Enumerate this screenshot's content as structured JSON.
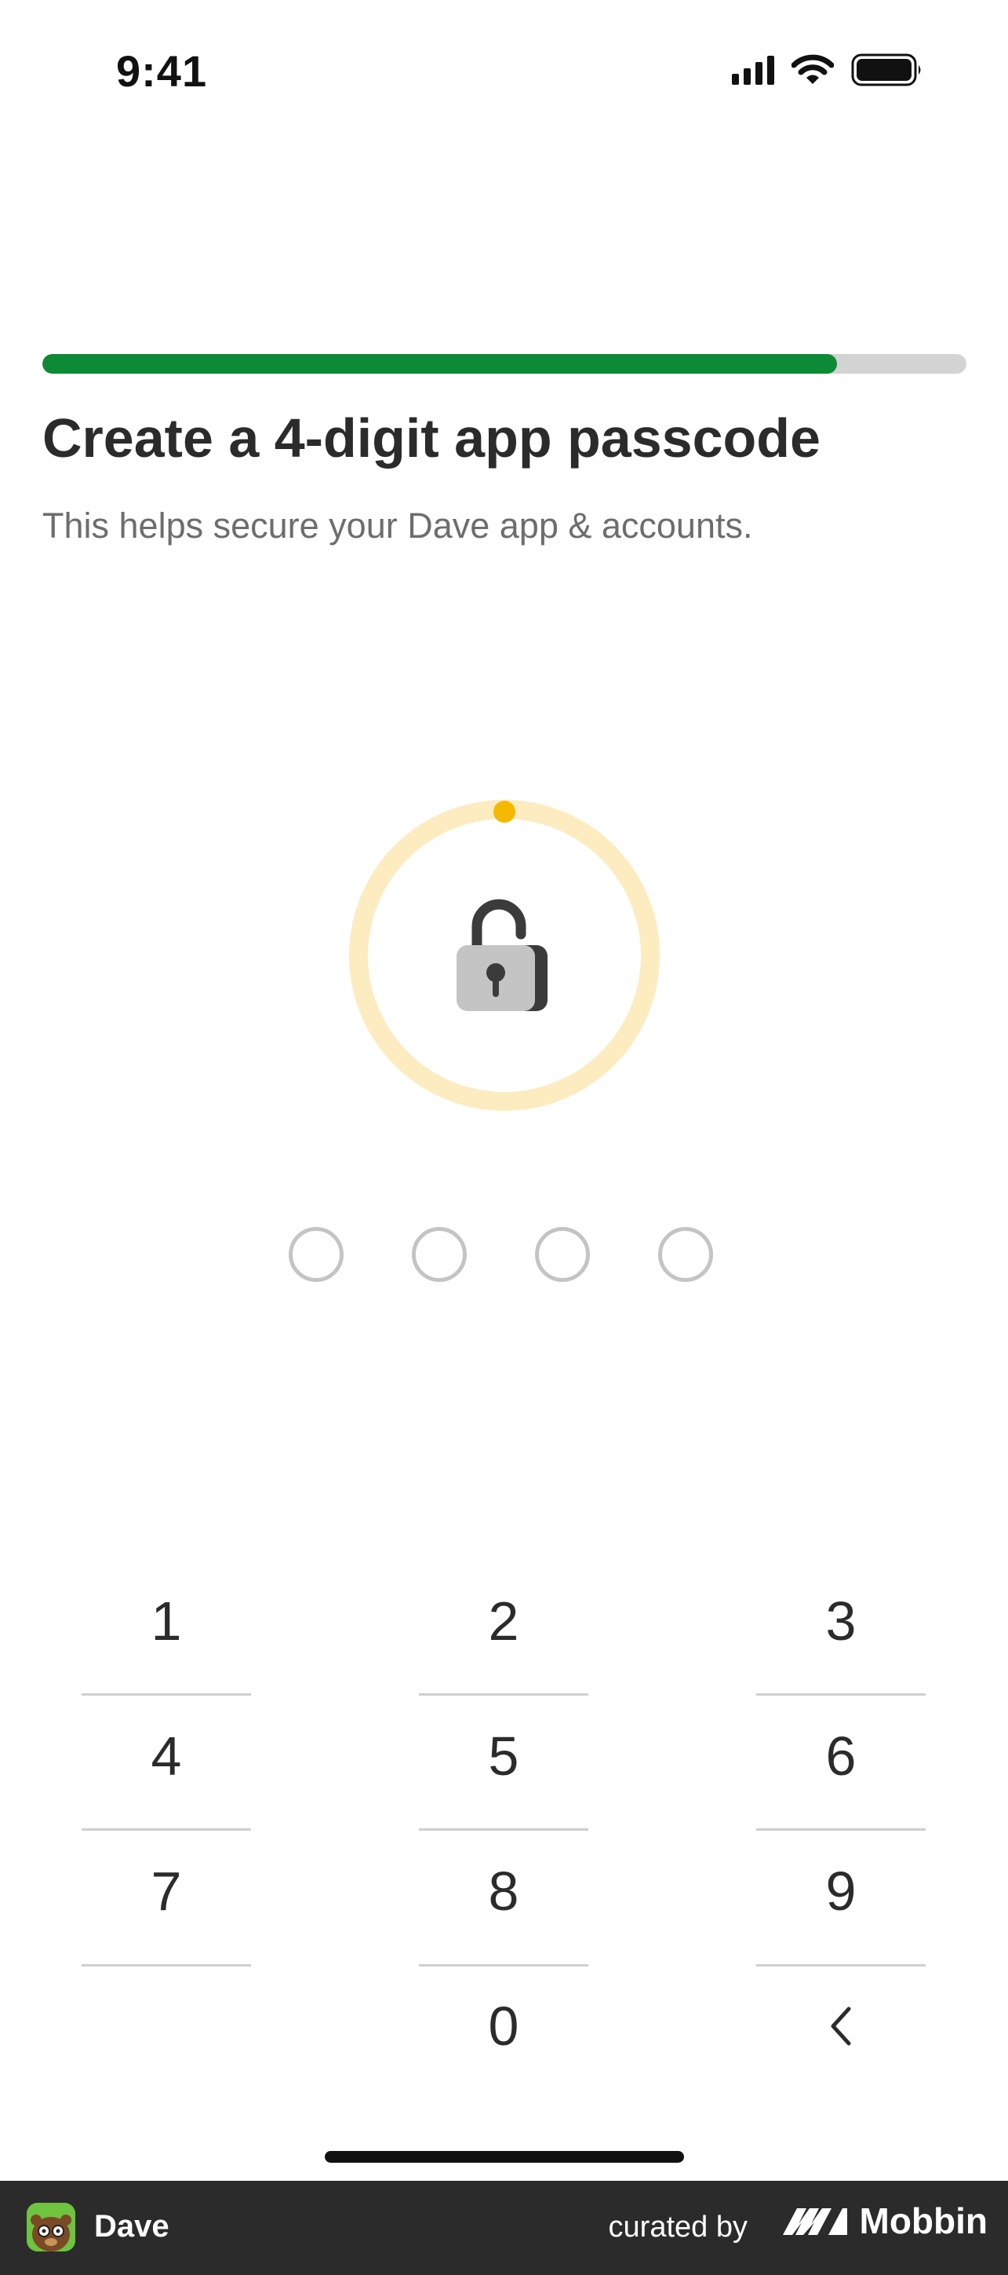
{
  "status_bar": {
    "time": "9:41",
    "icons": [
      "cellular-signal-icon",
      "wifi-icon",
      "battery-icon"
    ]
  },
  "onboarding": {
    "progress": 0.86,
    "progress_color": "#0c8a35",
    "track_color": "#d3d3d3"
  },
  "header": {
    "title": "Create a 4-digit app passcode",
    "subtitle": "This helps secure your Dave app & accounts."
  },
  "lock": {
    "icon": "unlocked-padlock-icon",
    "ring_color": "#fdecc0",
    "accent_color": "#f5b800"
  },
  "passcode": {
    "length": 4,
    "filled": 0
  },
  "keypad": {
    "keys": [
      "1",
      "2",
      "3",
      "4",
      "5",
      "6",
      "7",
      "8",
      "9",
      "",
      "0",
      "<"
    ],
    "backspace_icon": "chevron-left-icon"
  },
  "footer": {
    "app_name": "Dave",
    "curated_label": "curated by",
    "brand_name": "Mobbin"
  }
}
